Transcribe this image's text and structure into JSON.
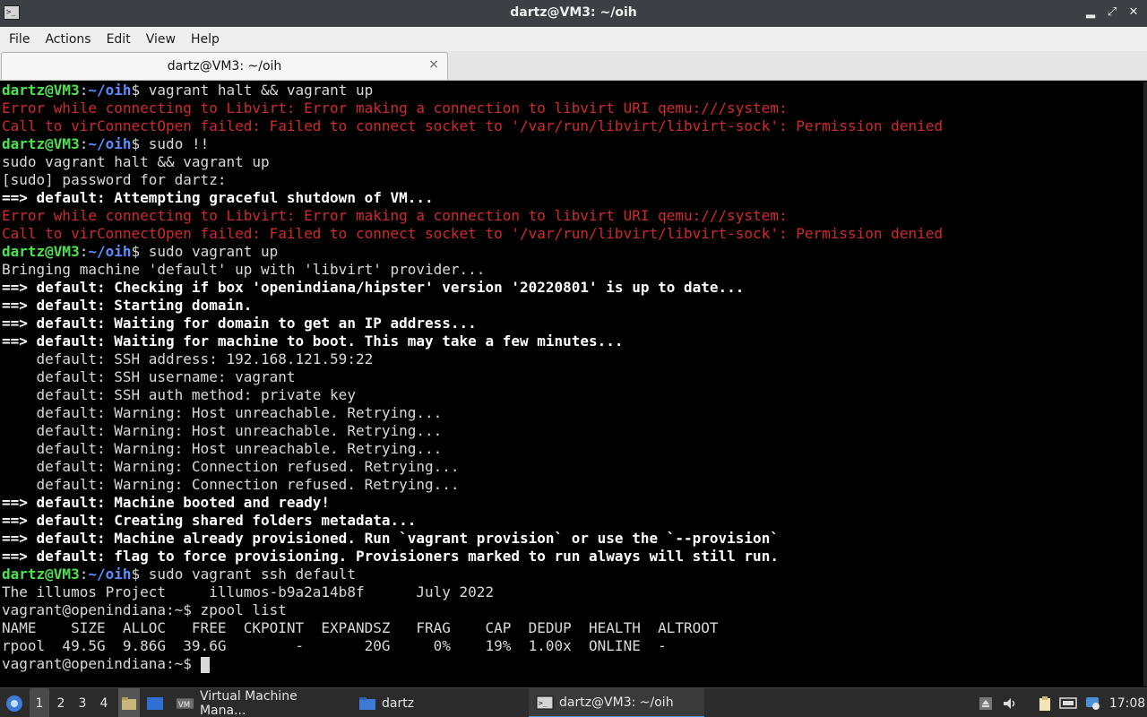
{
  "window": {
    "title": "dartz@VM3: ~/oih",
    "app_icon_glyph": ">_"
  },
  "menu": [
    "File",
    "Actions",
    "Edit",
    "View",
    "Help"
  ],
  "tab": {
    "label": "dartz@VM3: ~/oih",
    "close_glyph": "×"
  },
  "terminal": {
    "prompt_user": "dartz@VM3",
    "prompt_sep": ":",
    "prompt_path": "~/oih",
    "prompt_dollar": "$",
    "lines": [
      {
        "kind": "prompt",
        "cmd": " vagrant halt && vagrant up"
      },
      {
        "kind": "error",
        "text": "Error while connecting to Libvirt: Error making a connection to libvirt URI qemu:///system:"
      },
      {
        "kind": "error",
        "text": "Call to virConnectOpen failed: Failed to connect socket to '/var/run/libvirt/libvirt-sock': Permission denied"
      },
      {
        "kind": "prompt",
        "cmd": " sudo !!"
      },
      {
        "kind": "plain",
        "text": "sudo vagrant halt && vagrant up"
      },
      {
        "kind": "plain",
        "text": "[sudo] password for dartz:"
      },
      {
        "kind": "bold",
        "text": "==> default: Attempting graceful shutdown of VM..."
      },
      {
        "kind": "error",
        "text": "Error while connecting to Libvirt: Error making a connection to libvirt URI qemu:///system:"
      },
      {
        "kind": "error",
        "text": "Call to virConnectOpen failed: Failed to connect socket to '/var/run/libvirt/libvirt-sock': Permission denied"
      },
      {
        "kind": "prompt",
        "cmd": " sudo vagrant up"
      },
      {
        "kind": "plain",
        "text": "Bringing machine 'default' up with 'libvirt' provider..."
      },
      {
        "kind": "bold",
        "text": "==> default: Checking if box 'openindiana/hipster' version '20220801' is up to date..."
      },
      {
        "kind": "bold",
        "text": "==> default: Starting domain."
      },
      {
        "kind": "bold",
        "text": "==> default: Waiting for domain to get an IP address..."
      },
      {
        "kind": "bold",
        "text": "==> default: Waiting for machine to boot. This may take a few minutes..."
      },
      {
        "kind": "plain",
        "text": "    default: SSH address: 192.168.121.59:22"
      },
      {
        "kind": "plain",
        "text": "    default: SSH username: vagrant"
      },
      {
        "kind": "plain",
        "text": "    default: SSH auth method: private key"
      },
      {
        "kind": "plain",
        "text": "    default: Warning: Host unreachable. Retrying..."
      },
      {
        "kind": "plain",
        "text": "    default: Warning: Host unreachable. Retrying..."
      },
      {
        "kind": "plain",
        "text": "    default: Warning: Host unreachable. Retrying..."
      },
      {
        "kind": "plain",
        "text": "    default: Warning: Connection refused. Retrying..."
      },
      {
        "kind": "plain",
        "text": "    default: Warning: Connection refused. Retrying..."
      },
      {
        "kind": "bold",
        "text": "==> default: Machine booted and ready!"
      },
      {
        "kind": "bold",
        "text": "==> default: Creating shared folders metadata..."
      },
      {
        "kind": "bold",
        "text": "==> default: Machine already provisioned. Run `vagrant provision` or use the `--provision`"
      },
      {
        "kind": "bold",
        "text": "==> default: flag to force provisioning. Provisioners marked to run always will still run."
      },
      {
        "kind": "prompt",
        "cmd": " sudo vagrant ssh default"
      },
      {
        "kind": "plain",
        "text": "The illumos Project     illumos-b9a2a14b8f      July 2022"
      },
      {
        "kind": "plain",
        "text": "vagrant@openindiana:~$ zpool list"
      },
      {
        "kind": "plain",
        "text": "NAME    SIZE  ALLOC   FREE  CKPOINT  EXPANDSZ   FRAG    CAP  DEDUP  HEALTH  ALTROOT"
      },
      {
        "kind": "plain",
        "text": "rpool  49.5G  9.86G  39.6G        -       20G     0%    19%  1.00x  ONLINE  -"
      },
      {
        "kind": "cursor",
        "text": "vagrant@openindiana:~$ "
      }
    ]
  },
  "taskbar": {
    "workspaces": [
      "1",
      "2",
      "3",
      "4"
    ],
    "active_workspace": "1",
    "tasks": [
      {
        "label": "Virtual Machine Mana...",
        "icon": "virt-manager-icon"
      },
      {
        "label": "dartz",
        "icon": "folder-icon"
      },
      {
        "label": "dartz@VM3: ~/oih",
        "icon": "terminal-icon",
        "active": true
      }
    ],
    "clock": "17:08"
  },
  "colors": {
    "prompt_green": "#4fe24f",
    "prompt_blue": "#5c8cff",
    "error_red": "#d02a2a",
    "text": "#d9d9d9",
    "bold_text": "#ffffff"
  }
}
